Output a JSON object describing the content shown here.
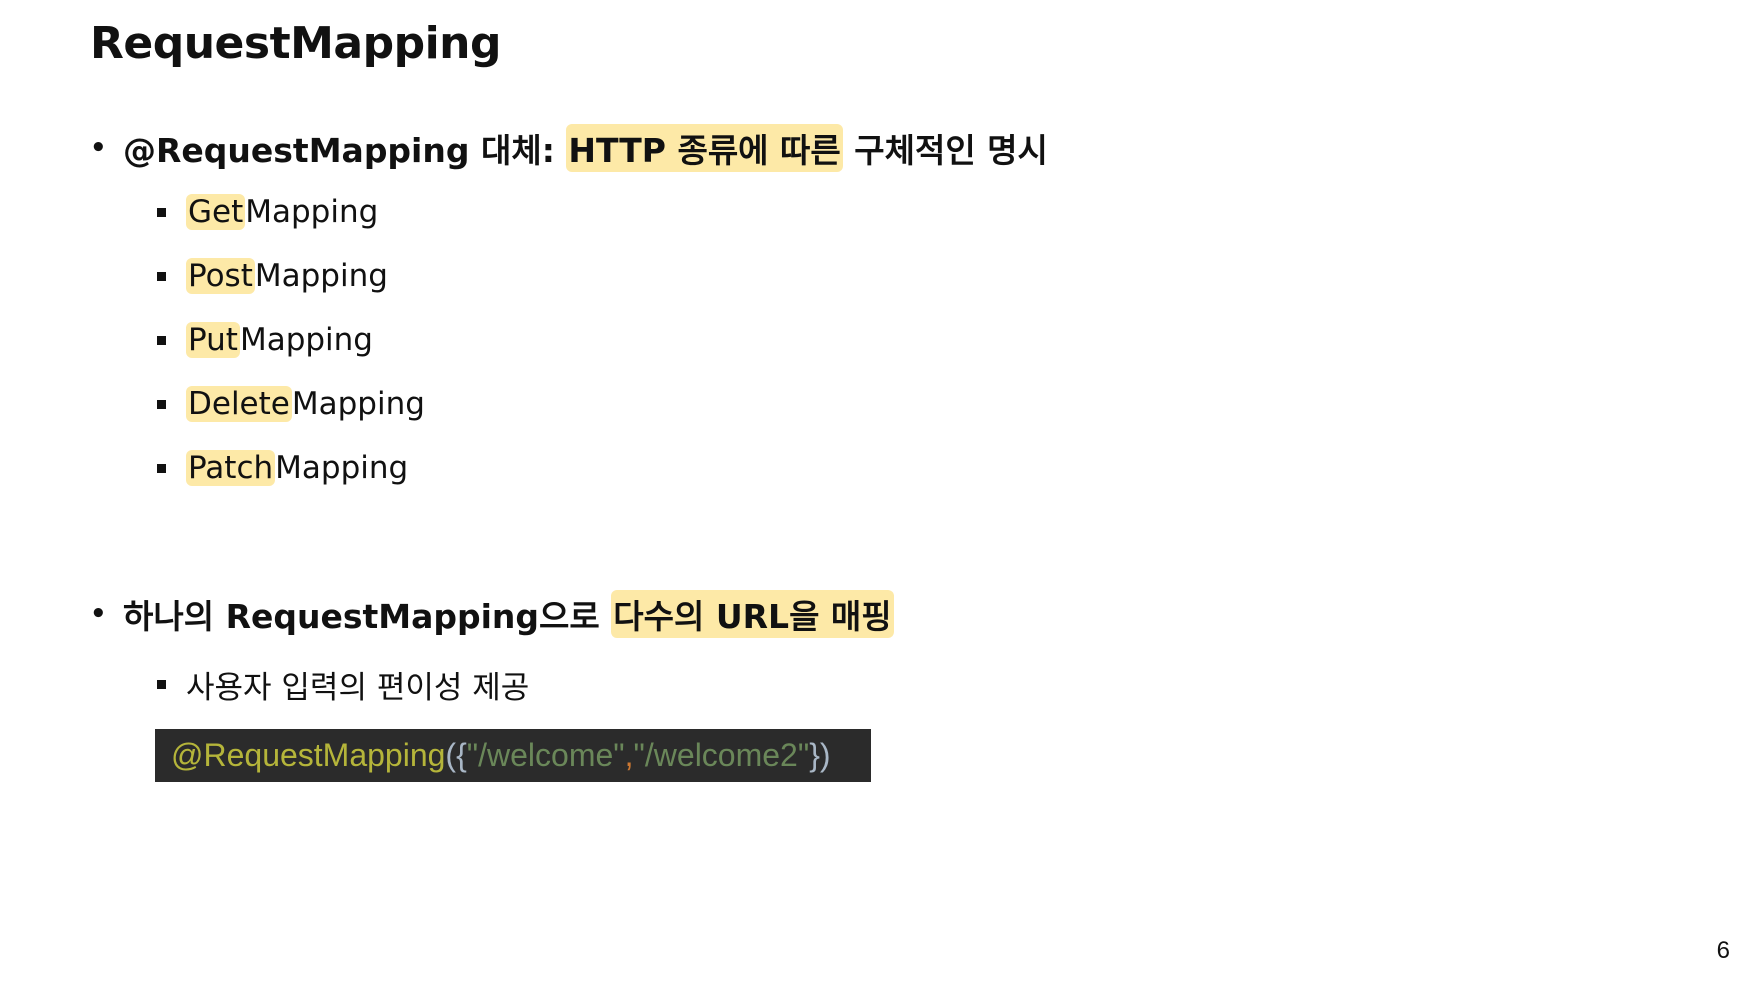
{
  "slide": {
    "title": "RequestMapping",
    "page_number": "6"
  },
  "bullet1": {
    "prefix": "@RequestMapping 대체: ",
    "highlight": "HTTP 종류에 따른",
    "suffix": " 구체적인 명시",
    "items": [
      {
        "highlight": "Get",
        "rest": "Mapping"
      },
      {
        "highlight": "Post",
        "rest": "Mapping"
      },
      {
        "highlight": "Put",
        "rest": "Mapping"
      },
      {
        "highlight": "Delete",
        "rest": "Mapping"
      },
      {
        "highlight": "Patch",
        "rest": "Mapping"
      }
    ]
  },
  "bullet2": {
    "prefix": "하나의 RequestMapping으로 ",
    "highlight": "다수의 URL을 매핑",
    "sub_item": "사용자 입력의 편이성 제공"
  },
  "code": {
    "annotation": "@RequestMapping",
    "open": "({",
    "str1": "\"/welcome\"",
    "comma": ",",
    "str2": "\"/welcome2\"",
    "close": "})"
  },
  "colors": {
    "highlight": "#fde9a7",
    "code_bg": "#2b2b2b",
    "code_annotation": "#b5b53a",
    "code_string": "#6a8759",
    "code_comma": "#cc7832",
    "code_punct": "#a9b7c6"
  }
}
